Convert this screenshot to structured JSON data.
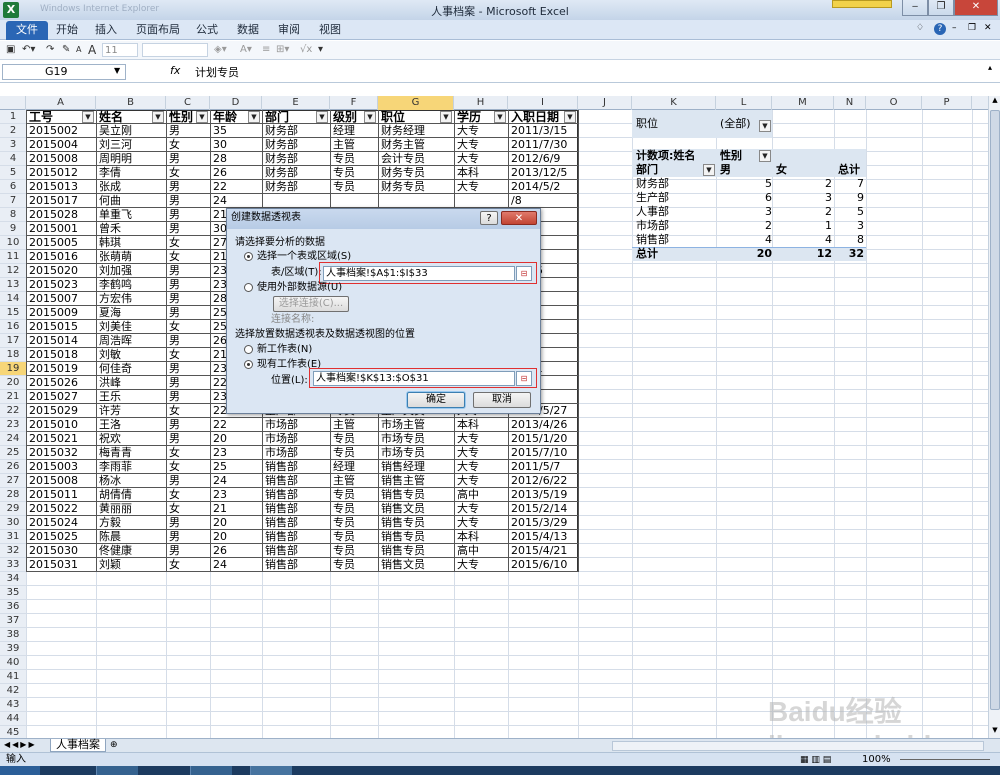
{
  "window": {
    "title": "人事档案 - Microsoft Excel",
    "bg_title": "Windows Internet Explorer"
  },
  "tabs": [
    "文件",
    "开始",
    "插入",
    "页面布局",
    "公式",
    "数据",
    "审阅",
    "视图"
  ],
  "qat": {
    "font_size": "11"
  },
  "namebox": "G19",
  "fx": "fx",
  "formula": "计划专员",
  "cols": [
    "A",
    "B",
    "C",
    "D",
    "E",
    "F",
    "G",
    "H",
    "I",
    "J",
    "K",
    "L",
    "M",
    "N",
    "O",
    "P"
  ],
  "headers": [
    "工号",
    "姓名",
    "性别",
    "年龄",
    "部门",
    "级别",
    "职位",
    "学历",
    "入职日期"
  ],
  "rows": [
    [
      "2015002",
      "吴立刚",
      "男",
      "35",
      "财务部",
      "经理",
      "财务经理",
      "大专",
      "2011/3/15"
    ],
    [
      "2015004",
      "刘三河",
      "女",
      "30",
      "财务部",
      "主管",
      "财务主管",
      "大专",
      "2011/7/30"
    ],
    [
      "2015008",
      "周明明",
      "男",
      "28",
      "财务部",
      "专员",
      "会计专员",
      "大专",
      "2012/6/9"
    ],
    [
      "2015012",
      "李倩",
      "女",
      "26",
      "财务部",
      "专员",
      "财务专员",
      "本科",
      "2013/12/5"
    ],
    [
      "2015013",
      "张成",
      "男",
      "22",
      "财务部",
      "专员",
      "财务专员",
      "大专",
      "2014/5/2"
    ],
    [
      "2015017",
      "何曲",
      "男",
      "24",
      "",
      "",
      "",
      "",
      "/8"
    ],
    [
      "2015028",
      "单重飞",
      "男",
      "21",
      "",
      "",
      "",
      "",
      "/22"
    ],
    [
      "2015001",
      "曾禾",
      "男",
      "30",
      "",
      "",
      "",
      "",
      "1/9"
    ],
    [
      "2015005",
      "韩琪",
      "女",
      "27",
      "",
      "",
      "",
      "",
      "/18"
    ],
    [
      "2015016",
      "张萌萌",
      "女",
      "21",
      "",
      "",
      "",
      "",
      "/24"
    ],
    [
      "2015020",
      "刘加强",
      "男",
      "23",
      "",
      "",
      "",
      "",
      "11/16"
    ],
    [
      "2015023",
      "李鹤鸣",
      "男",
      "23",
      "",
      "",
      "",
      "",
      "/21"
    ],
    [
      "2015007",
      "方宏伟",
      "男",
      "28",
      "",
      "",
      "",
      "",
      "/17"
    ],
    [
      "2015009",
      "夏海",
      "男",
      "25",
      "",
      "",
      "",
      "",
      "12/8"
    ],
    [
      "2015015",
      "刘美佳",
      "女",
      "25",
      "",
      "",
      "",
      "",
      "/10"
    ],
    [
      "2015014",
      "周浩晖",
      "男",
      "26",
      "",
      "",
      "",
      "",
      "/22"
    ],
    [
      "2015018",
      "刘敏",
      "女",
      "21",
      "",
      "",
      "",
      "",
      "10/2"
    ],
    [
      "2015019",
      "何佳奇",
      "男",
      "23",
      "",
      "",
      "",
      "",
      "11/11"
    ],
    [
      "2015026",
      "洪峰",
      "男",
      "22",
      "",
      "",
      "",
      "",
      "4/17"
    ],
    [
      "2015027",
      "王乐",
      "男",
      "23",
      "",
      "",
      "",
      "",
      "/19"
    ],
    [
      "2015029",
      "许芳",
      "女",
      "22",
      "生产部",
      "专员",
      "生产文员",
      "大专",
      "2015/5/27"
    ],
    [
      "2015010",
      "王洛",
      "男",
      "22",
      "市场部",
      "主管",
      "市场主管",
      "本科",
      "2013/4/26"
    ],
    [
      "2015021",
      "祝欢",
      "男",
      "20",
      "市场部",
      "专员",
      "市场专员",
      "大专",
      "2015/1/20"
    ],
    [
      "2015032",
      "梅青青",
      "女",
      "23",
      "市场部",
      "专员",
      "市场专员",
      "大专",
      "2015/7/10"
    ],
    [
      "2015003",
      "李雨菲",
      "女",
      "25",
      "销售部",
      "经理",
      "销售经理",
      "大专",
      "2011/5/7"
    ],
    [
      "2015008",
      "杨冰",
      "男",
      "24",
      "销售部",
      "主管",
      "销售主管",
      "大专",
      "2012/6/22"
    ],
    [
      "2015011",
      "胡倩倩",
      "女",
      "23",
      "销售部",
      "专员",
      "销售专员",
      "高中",
      "2013/5/19"
    ],
    [
      "2015022",
      "黄丽丽",
      "女",
      "21",
      "销售部",
      "专员",
      "销售文员",
      "大专",
      "2015/2/14"
    ],
    [
      "2015024",
      "方毅",
      "男",
      "20",
      "销售部",
      "专员",
      "销售专员",
      "大专",
      "2015/3/29"
    ],
    [
      "2015025",
      "陈晨",
      "男",
      "20",
      "销售部",
      "专员",
      "销售专员",
      "本科",
      "2015/4/13"
    ],
    [
      "2015030",
      "佟健康",
      "男",
      "26",
      "销售部",
      "专员",
      "销售专员",
      "高中",
      "2015/4/21"
    ],
    [
      "2015031",
      "刘颖",
      "女",
      "24",
      "销售部",
      "专员",
      "销售文员",
      "大专",
      "2015/6/10"
    ]
  ],
  "pivot": {
    "filter_label": "职位",
    "filter_value": "(全部)",
    "count_label": "计数项:姓名",
    "col_label": "性别",
    "row_label": "部门",
    "col_male": "男",
    "col_female": "女",
    "col_total": "总计",
    "rows": [
      [
        "财务部",
        "5",
        "2",
        "7"
      ],
      [
        "生产部",
        "6",
        "3",
        "9"
      ],
      [
        "人事部",
        "3",
        "2",
        "5"
      ],
      [
        "市场部",
        "2",
        "1",
        "3"
      ],
      [
        "销售部",
        "4",
        "4",
        "8"
      ]
    ],
    "total": [
      "总计",
      "20",
      "12",
      "32"
    ]
  },
  "dialog": {
    "title": "创建数据透视表",
    "section1": "请选择要分析的数据",
    "opt_range": "选择一个表或区域(S)",
    "range_label": "表/区域(T):",
    "range_value": "人事档案!$A$1:$I$33",
    "opt_external": "使用外部数据源(U)",
    "choose_conn": "选择连接(C)...",
    "conn_name": "连接名称:",
    "section2": "选择放置数据透视表及数据透视图的位置",
    "opt_new": "新工作表(N)",
    "opt_existing": "现有工作表(E)",
    "location_label": "位置(L):",
    "location_value": "人事档案!$K$13:$O$31",
    "ok": "确定",
    "cancel": "取消",
    "help": "?",
    "close": "✕"
  },
  "sheet_tab": "人事档案",
  "status": {
    "mode": "输入",
    "zoom": "100%"
  },
  "watermark": "Baidu经验 jingyan.baidu.com"
}
